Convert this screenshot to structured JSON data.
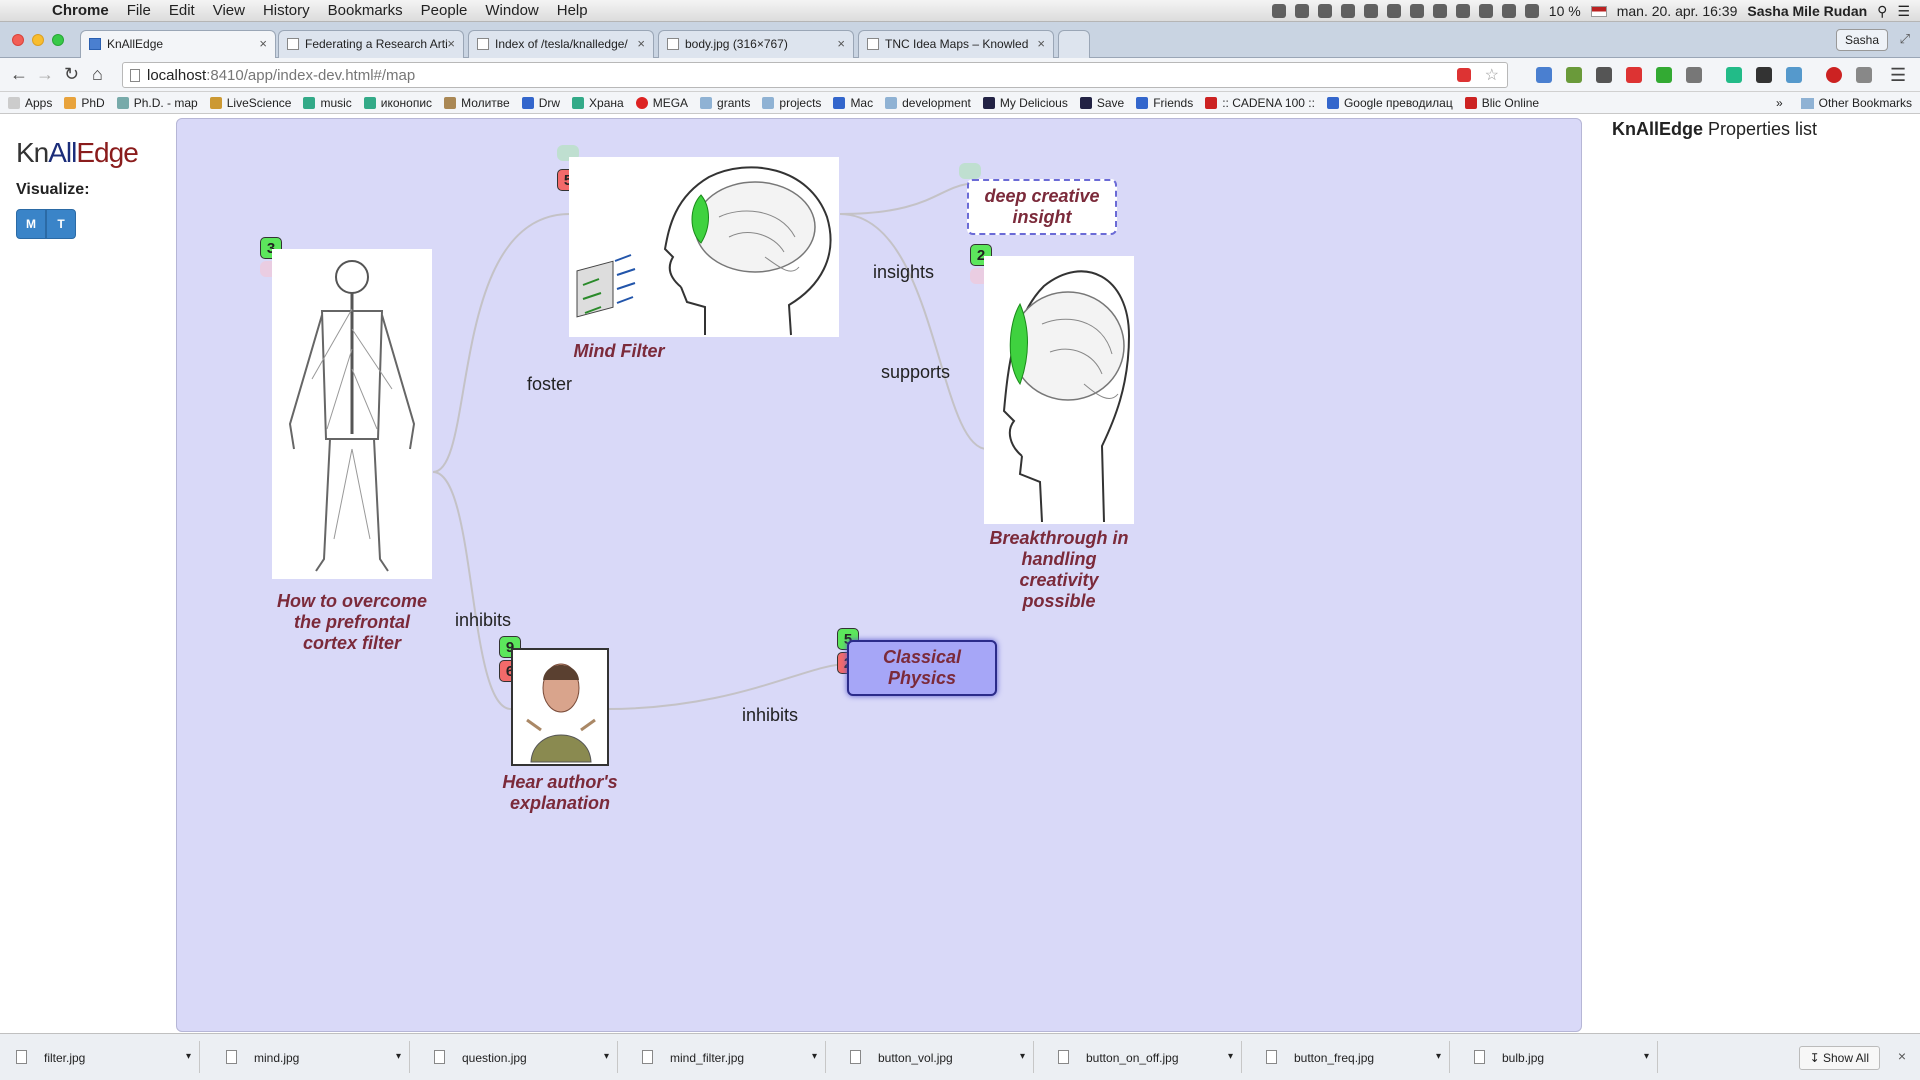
{
  "menubar": {
    "apple_icon": "apple-icon",
    "app_name": "Chrome",
    "items": [
      "File",
      "Edit",
      "View",
      "History",
      "Bookmarks",
      "People",
      "Window",
      "Help"
    ],
    "battery": "10 %",
    "clock": "man. 20. apr.  16:39",
    "user": "Sasha Mile Rudan"
  },
  "tabs": [
    {
      "title": "KnAllEdge",
      "active": true
    },
    {
      "title": "Federating a Research Arti",
      "active": false
    },
    {
      "title": "Index of /tesla/knalledge/",
      "active": false
    },
    {
      "title": "body.jpg (316×767)",
      "active": false
    },
    {
      "title": "TNC Idea Maps – Knowled",
      "active": false
    }
  ],
  "profile_name": "Sasha",
  "address": {
    "host": "localhost",
    "path": ":8410/app/index-dev.html#/map"
  },
  "bookmarks": [
    {
      "label": "Apps",
      "icon": "apps-grid-icon"
    },
    {
      "label": "PhD",
      "icon": "bookmark-icon"
    },
    {
      "label": "Ph.D. - map",
      "icon": "bookmark-icon"
    },
    {
      "label": "LiveScience",
      "icon": "bookmark-icon"
    },
    {
      "label": "music",
      "icon": "bookmark-icon"
    },
    {
      "label": "иконопис",
      "icon": "bookmark-icon"
    },
    {
      "label": "Молитве",
      "icon": "bookmark-icon"
    },
    {
      "label": "Drw",
      "icon": "bookmark-icon"
    },
    {
      "label": "Храна",
      "icon": "bookmark-icon"
    },
    {
      "label": "MEGA",
      "icon": "bookmark-icon"
    },
    {
      "label": "grants",
      "icon": "folder-icon"
    },
    {
      "label": "projects",
      "icon": "folder-icon"
    },
    {
      "label": "Mac",
      "icon": "bookmark-icon"
    },
    {
      "label": "development",
      "icon": "folder-icon"
    },
    {
      "label": "My Delicious",
      "icon": "bookmark-icon"
    },
    {
      "label": "Save",
      "icon": "bookmark-icon"
    },
    {
      "label": "Friends",
      "icon": "bookmark-icon"
    },
    {
      "label": ":: CADENA 100 ::",
      "icon": "bookmark-icon"
    },
    {
      "label": "Google преводилац",
      "icon": "bookmark-icon"
    },
    {
      "label": "Blic Online",
      "icon": "bookmark-icon"
    }
  ],
  "other_bookmarks": "Other Bookmarks",
  "app": {
    "logo": {
      "kn": "Kn",
      "all": "All",
      "edge": "Edge"
    },
    "visualize_label": "Visualize:",
    "vis_buttons": [
      "M",
      "T"
    ],
    "props_title_bold": "KnAllEdge",
    "props_title_rest": " Properties list"
  },
  "map": {
    "nodes": {
      "body": {
        "label": "How to overcome the prefrontal cortex filter",
        "badge_green": "3",
        "image": "body-anatomy-image"
      },
      "mind_filter": {
        "label": "Mind Filter",
        "badge_red": "5",
        "image": "head-with-filter-image"
      },
      "deep_insight": {
        "label": "deep creative insight"
      },
      "breakthrough": {
        "label": "Breakthrough in handling creativity possible",
        "badge_green": "2",
        "image": "brain-head-image"
      },
      "author": {
        "label": "Hear author's explanation",
        "badge_green": "9",
        "badge_red": "6",
        "image": "author-photo-image"
      },
      "physics": {
        "label": "Classical Physics",
        "badge_green": "5",
        "badge_red": "2"
      }
    },
    "edges": {
      "foster": "foster",
      "insights": "insights",
      "supports": "supports",
      "inhibits_1": "inhibits",
      "inhibits_2": "inhibits"
    }
  },
  "downloads": [
    "filter.jpg",
    "mind.jpg",
    "question.jpg",
    "mind_filter.jpg",
    "button_vol.jpg",
    "button_on_off.jpg",
    "button_freq.jpg",
    "bulb.jpg"
  ],
  "show_all": "Show All",
  "colors": {
    "canvas": "#d9d9f8",
    "node_label": "#7b2a3a",
    "badge_green": "#5ce65c",
    "badge_red": "#f36a6a",
    "selected_node": "#a6a6f7",
    "vis_button": "#3a84c8"
  }
}
